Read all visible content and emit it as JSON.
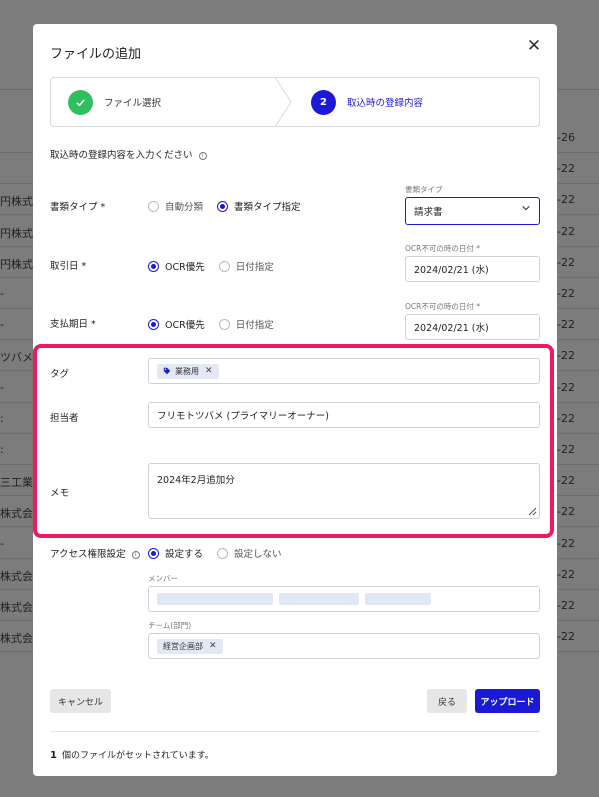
{
  "background": {
    "rows": [
      {
        "left": "",
        "right": "-26"
      },
      {
        "left": "",
        "right": "-22"
      },
      {
        "left": "円株式会",
        "right": "-22"
      },
      {
        "left": "円株式会",
        "right": "-22"
      },
      {
        "left": "円株式会",
        "right": "-22"
      },
      {
        "left": "-",
        "right": "-22"
      },
      {
        "left": "-",
        "right": "-22"
      },
      {
        "left": "ツバメ",
        "right": "-22"
      },
      {
        "left": "-",
        "right": "-22"
      },
      {
        "left": ":",
        "right": "-22"
      },
      {
        "left": ":",
        "right": "-22"
      },
      {
        "left": "三工業",
        "right": "-22"
      },
      {
        "left": "株式会",
        "right": "-22"
      },
      {
        "left": "-",
        "right": "-22"
      },
      {
        "left": "株式会",
        "right": "-22"
      },
      {
        "left": "株式会",
        "right": "-22"
      },
      {
        "left": "株式会",
        "right": "-22"
      }
    ]
  },
  "modal": {
    "title": "ファイルの追加",
    "close_icon": "close-icon",
    "stepper": {
      "step1": {
        "label": "ファイル選択",
        "icon": "check-icon",
        "status": "complete"
      },
      "step2": {
        "number": "2",
        "label": "取込時の登録内容",
        "status": "active"
      }
    },
    "intro": "取込時の登録内容を入力ください",
    "fields": {
      "doc_type": {
        "label": "書類タイプ *",
        "options": [
          "自動分類",
          "書類タイプ指定"
        ],
        "selected": "書類タイプ指定",
        "select_label": "書類タイプ",
        "select_value": "請求書"
      },
      "trade_date": {
        "label": "取引日 *",
        "options": [
          "OCR優先",
          "日付指定"
        ],
        "selected": "OCR優先",
        "fallback_label": "OCR不可の時の日付 *",
        "fallback_value": "2024/02/21 (水)"
      },
      "due_date": {
        "label": "支払期日 *",
        "options": [
          "OCR優先",
          "日付指定"
        ],
        "selected": "OCR優先",
        "fallback_label": "OCR不可の時の日付 *",
        "fallback_value": "2024/02/21 (水)"
      },
      "tag": {
        "label": "タグ",
        "chips": [
          "業務用"
        ]
      },
      "assignee": {
        "label": "担当者",
        "value": "フリモトツバメ (プライマリーオーナー)"
      },
      "memo": {
        "label": "メモ",
        "value": "2024年2月追加分"
      },
      "access": {
        "label": "アクセス権限設定",
        "options": [
          "設定する",
          "設定しない"
        ],
        "selected": "設定する",
        "members_label": "メンバー",
        "team_label": "チーム(部門)",
        "team_chips": [
          "経営企画部"
        ]
      }
    },
    "buttons": {
      "cancel": "キャンセル",
      "back": "戻る",
      "upload": "アップロード"
    },
    "footer": {
      "count": "1",
      "text": "個のファイルがセットされています。"
    },
    "colors": {
      "accent": "#1a1ad6",
      "highlight": "#ee1a5c",
      "success": "#2fbf5f"
    }
  }
}
